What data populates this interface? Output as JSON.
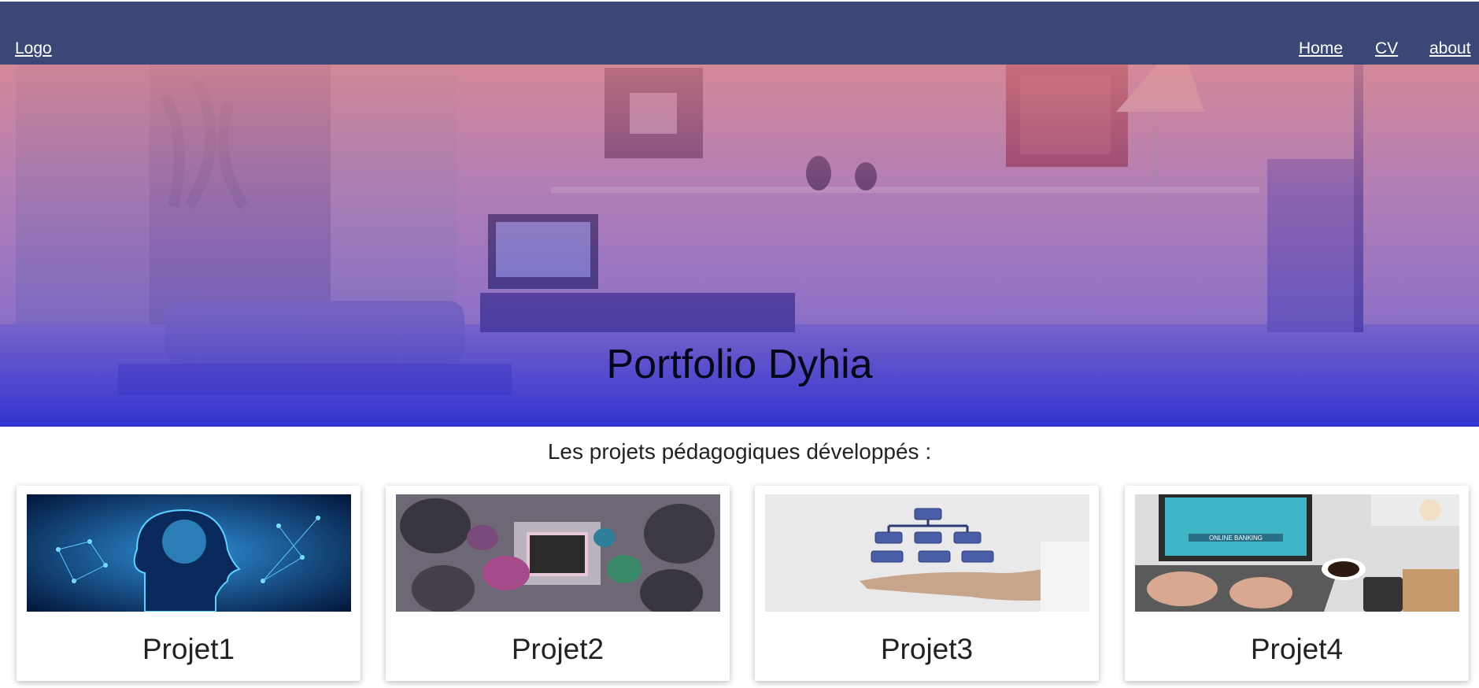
{
  "nav": {
    "logo": "Logo",
    "links": [
      "Home",
      "CV",
      "about"
    ]
  },
  "hero": {
    "title": "Portfolio Dyhia"
  },
  "section": {
    "title": "Les projets pédagogiques développés :"
  },
  "projects": [
    {
      "label": "Projet1",
      "image": "ai-brain-network-image"
    },
    {
      "label": "Projet2",
      "image": "abstract-3d-room-image"
    },
    {
      "label": "Projet3",
      "image": "hierarchy-chart-hand-image"
    },
    {
      "label": "Projet4",
      "image": "online-banking-laptop-image"
    }
  ],
  "colors": {
    "navbar": "#3b4875",
    "hero_top": "#d7828c",
    "hero_bottom": "#2e2ed2"
  }
}
